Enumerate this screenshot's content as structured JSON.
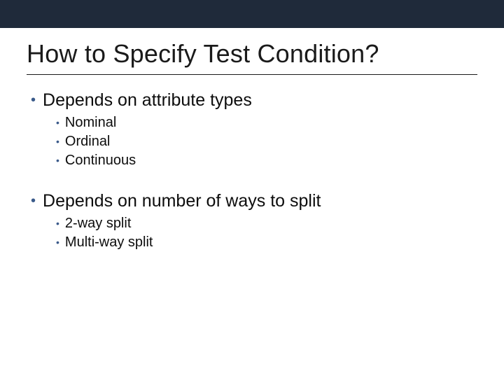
{
  "title": "How to Specify Test Condition?",
  "bullets": {
    "b1": {
      "text": "Depends on attribute types",
      "sub": {
        "s1": "Nominal",
        "s2": "Ordinal",
        "s3": "Continuous"
      }
    },
    "b2": {
      "text": "Depends on number of ways to split",
      "sub": {
        "s1": "2-way split",
        "s2": "Multi-way split"
      }
    }
  }
}
